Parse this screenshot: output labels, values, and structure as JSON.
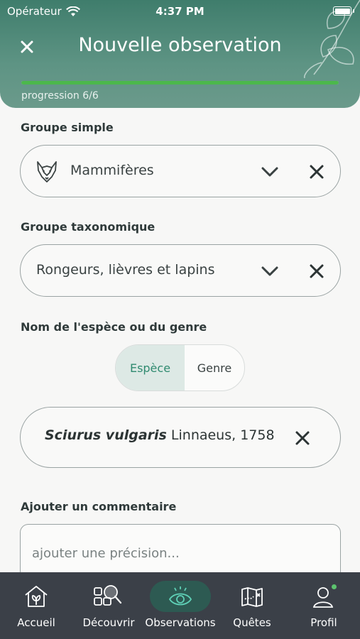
{
  "status_bar": {
    "carrier": "Opérateur",
    "time": "4:37 PM"
  },
  "header": {
    "title": "Nouvelle observation",
    "progress_label": "progression 6/6",
    "progress_fraction": 1.0,
    "close_icon": "close-icon"
  },
  "form": {
    "simple_group": {
      "label": "Groupe simple",
      "value": "Mammifères",
      "icon": "fox-icon"
    },
    "taxonomic_group": {
      "label": "Groupe taxonomique",
      "value": "Rongeurs, lièvres et lapins"
    },
    "species": {
      "label": "Nom de l'espèce ou du genre",
      "toggle": {
        "options": [
          "Espèce",
          "Genre"
        ],
        "selected": "Espèce"
      },
      "scientific_name": "Sciurus vulgaris",
      "authority": "Linnaeus, 1758"
    },
    "comment": {
      "label": "Ajouter un commentaire",
      "placeholder": "ajouter une précision..."
    }
  },
  "tabbar": {
    "active": "Observations",
    "items": [
      {
        "label": "Accueil",
        "icon": "home-icon"
      },
      {
        "label": "Découvrir",
        "icon": "discover-icon"
      },
      {
        "label": "Observations",
        "icon": "eye-icon"
      },
      {
        "label": "Quêtes",
        "icon": "map-icon"
      },
      {
        "label": "Profil",
        "icon": "profile-icon"
      }
    ]
  },
  "colors": {
    "header_bg": "#4a8574",
    "progress_fill": "#4cb84c",
    "accent_text": "#2f8a6f",
    "tabbar_bg": "#3b4048",
    "active_tab_pill": "#2d5a52"
  }
}
